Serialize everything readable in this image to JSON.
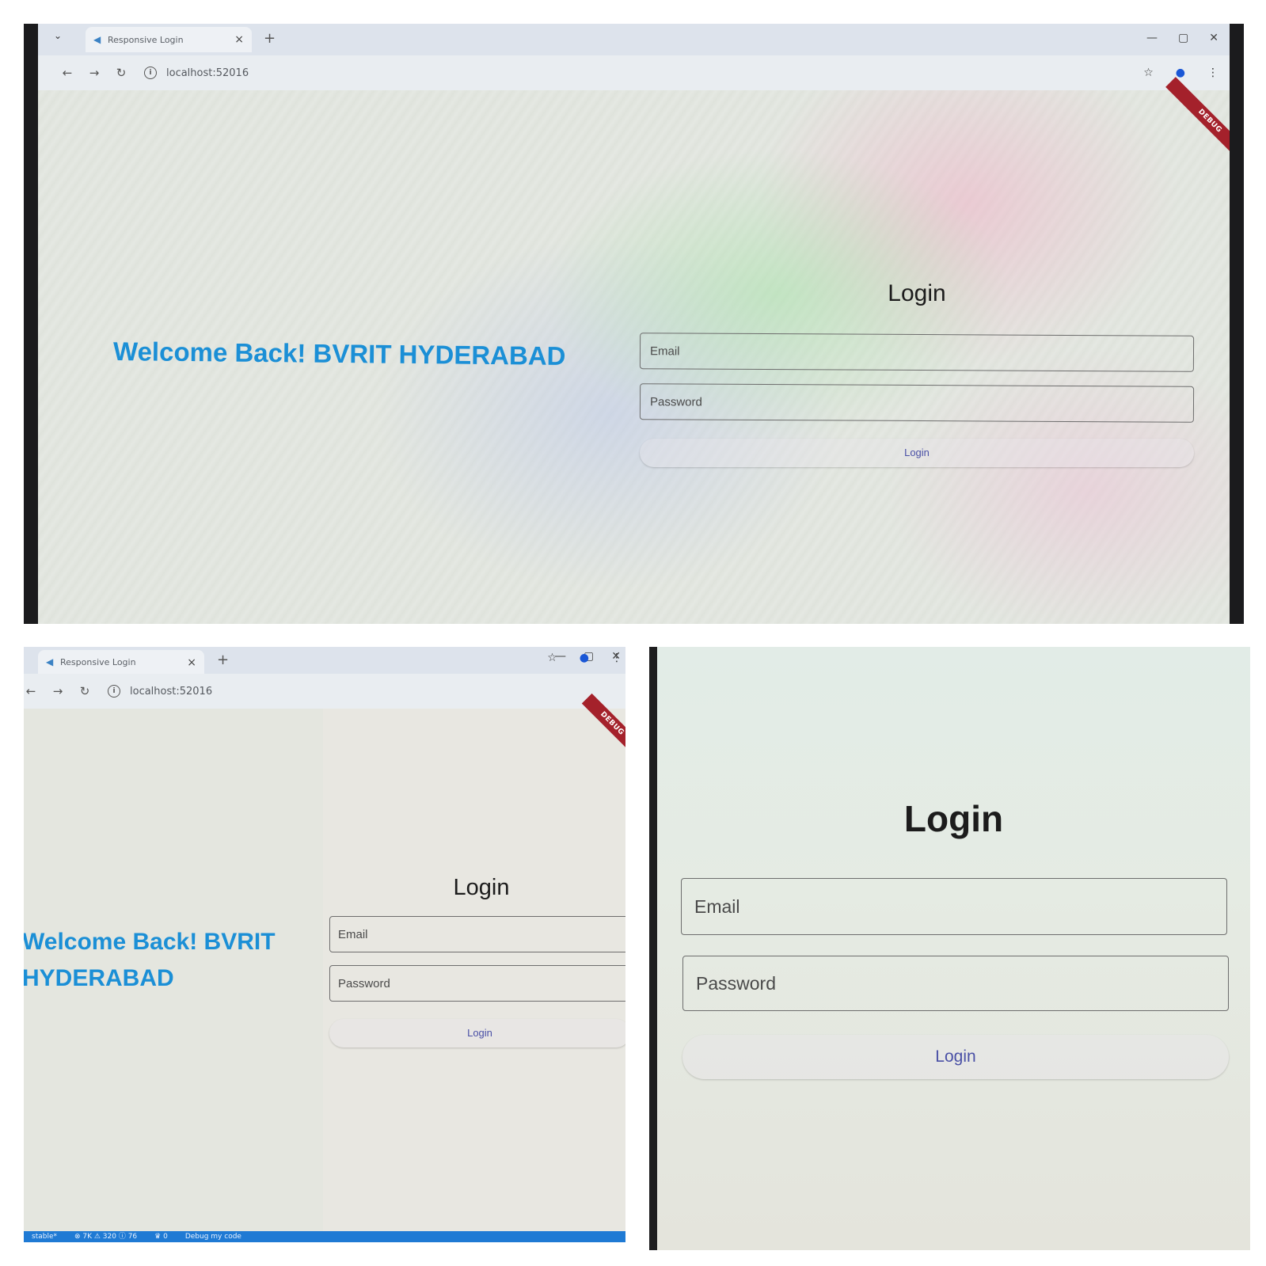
{
  "browser": {
    "tab_title": "Responsive Login",
    "new_tab_symbol": "+",
    "tab_close_symbol": "×",
    "url": "localhost:52016"
  },
  "debug_banner": "DEBUG",
  "app": {
    "welcome_text": "Welcome Back! BVRIT HYDERABAD",
    "welcome_line_1": "Welcome Back! BVRIT",
    "welcome_line_2": "HYDERABAD",
    "login_title": "Login",
    "email_label": "Email",
    "password_label": "Password",
    "login_button": "Login"
  },
  "status_bar": {
    "items": [
      "stable*",
      "⊗ 7K ⚠ 320 ⓘ 76",
      "♛ 0",
      "Debug my code"
    ]
  },
  "colors": {
    "welcome_text": "#1b8fd6",
    "login_button_text": "#4a50a6",
    "debug_banner": "#a4212b",
    "status_bar": "#1f7ad4"
  },
  "icons": {
    "back": "←",
    "forward": "→",
    "reload": "↻",
    "info": "i",
    "star": "☆",
    "profile": "●",
    "menu": "⋮",
    "minimize": "—",
    "maximize": "▢",
    "close": "✕",
    "tab_list": "⌄"
  }
}
